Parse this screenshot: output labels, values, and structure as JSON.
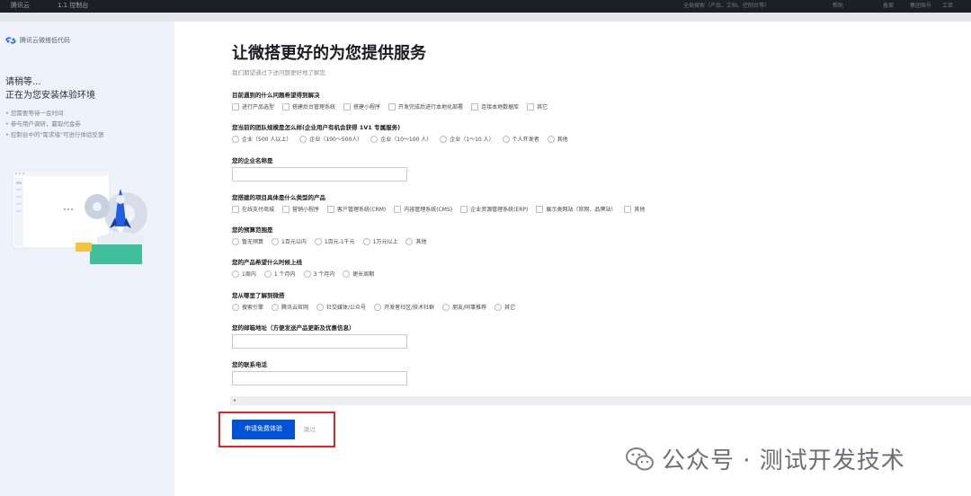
{
  "topbar": {
    "brand": "腾讯云",
    "workspace": "1.1 控制台",
    "search_placeholder": "全局搜索（产品、文档、控制台等）",
    "nav": [
      "帮助",
      "备案",
      "集团账号",
      "工单"
    ]
  },
  "sidebar": {
    "logo_text": "腾讯云微搭低代码",
    "wait_title": "请稍等...",
    "installing_title": "正在为您安装体验环境",
    "tips": [
      "• 您需要等待一会时间",
      "• 参与用户调研，赢取代金券",
      "• 控制台中的\"需求墙\"可进行体验反馈"
    ]
  },
  "form": {
    "title": "让微搭更好的为您提供服务",
    "subtitle": "我们期望通过下述问题更好地了解您",
    "q1": {
      "label": "目前遇到的什么问题希望得到解决",
      "options": [
        "进行产品选型",
        "搭建后台管理系统",
        "搭建小程序",
        "开发完成后进行本地化部署",
        "连接本地数据库",
        "其它"
      ]
    },
    "q2": {
      "label": "您当前的团队规模是怎么样(企业用户有机会获得 1V1 专属服务)",
      "options": [
        "企业（500 人以上）",
        "企业（100～500人）",
        "企业（10～100 人）",
        "企业（1～10 人）",
        "个人开发者",
        "其他"
      ]
    },
    "q3": {
      "label": "您的企业名称是",
      "value": ""
    },
    "q4": {
      "label": "您搭建的项目具体是什么类型的产品",
      "options": [
        "在线支付商城",
        "营销小程序",
        "客户管理系统(CRM)",
        "内容管理系统(CMS)",
        "企业资源管理系统(ERP)",
        "展示类网站（官网、品牌站）",
        "其他"
      ]
    },
    "q5": {
      "label": "您的预算范围是",
      "options": [
        "暂无预算",
        "1百元以内",
        "1百元-1千元",
        "1万元以上",
        "其他"
      ]
    },
    "q6": {
      "label": "您的产品希望什么时候上线",
      "options": [
        "1周内",
        "1 个月内",
        "3 个月内",
        "更长周期"
      ]
    },
    "q7": {
      "label": "您从哪里了解到微搭",
      "options": [
        "搜索引擎",
        "腾讯云官网",
        "社交媒体/公众号",
        "开发者社区/技术社群",
        "朋友/同事推荐",
        "其它"
      ]
    },
    "q8": {
      "label": "您的邮箱地址（方便发送产品更新及优惠信息）",
      "value": ""
    },
    "q9": {
      "label": "您的联系电话",
      "value": ""
    },
    "submit_label": "申请免费体验",
    "skip_label": "跳过"
  },
  "watermark": {
    "text": "公众号 · 测试开发技术"
  },
  "colors": {
    "primary": "#0052d9",
    "highlight": "#e02424",
    "sidebar_bg": "#eef3fb"
  }
}
